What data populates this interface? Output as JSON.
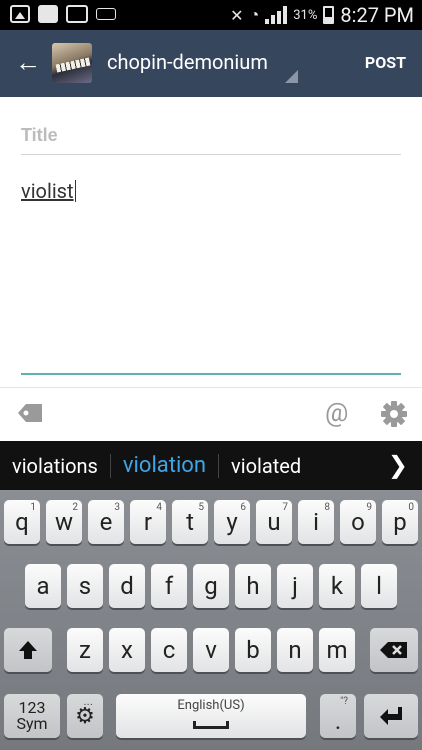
{
  "status": {
    "battery": "31%",
    "time": "8:27 PM"
  },
  "header": {
    "blog_name": "chopin-demonium",
    "post_label": "POST"
  },
  "editor": {
    "title_placeholder": "Title",
    "body_text": "violist"
  },
  "suggestions": [
    "violations",
    "violation",
    "violated"
  ],
  "keyboard": {
    "row1": [
      {
        "key": "q",
        "alt": "1"
      },
      {
        "key": "w",
        "alt": "2"
      },
      {
        "key": "e",
        "alt": "3"
      },
      {
        "key": "r",
        "alt": "4"
      },
      {
        "key": "t",
        "alt": "5"
      },
      {
        "key": "y",
        "alt": "6"
      },
      {
        "key": "u",
        "alt": "7"
      },
      {
        "key": "i",
        "alt": "8"
      },
      {
        "key": "o",
        "alt": "9"
      },
      {
        "key": "p",
        "alt": "0"
      }
    ],
    "row2": [
      "a",
      "s",
      "d",
      "f",
      "g",
      "h",
      "j",
      "k",
      "l"
    ],
    "row3": [
      "z",
      "x",
      "c",
      "v",
      "b",
      "n",
      "m"
    ],
    "sym_label_1": "123",
    "sym_label_2": "Sym",
    "settings_hint": "...",
    "space_label": "English(US)",
    "period_hint": "\"?",
    "period": "."
  }
}
